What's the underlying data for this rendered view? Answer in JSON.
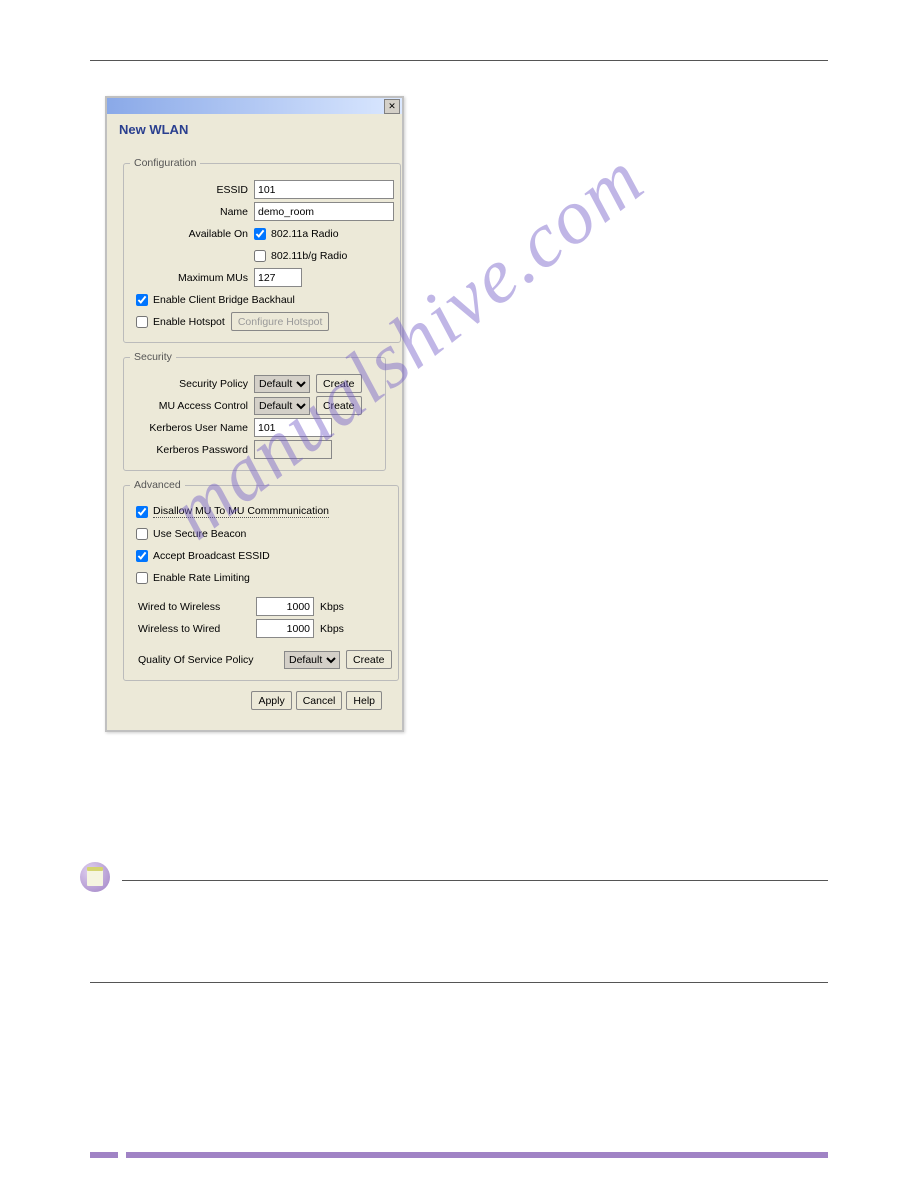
{
  "dialog": {
    "title": "New WLAN",
    "closeGlyph": "✕"
  },
  "configuration": {
    "legend": "Configuration",
    "essidLabel": "ESSID",
    "essid": "101",
    "nameLabel": "Name",
    "name": "demo_room",
    "availableOnLabel": "Available On",
    "radio80211a": {
      "checked": true,
      "label": "802.11a Radio"
    },
    "radio80211bg": {
      "checked": false,
      "label": "802.11b/g Radio"
    },
    "maxMUsLabel": "Maximum MUs",
    "maxMUs": "127",
    "enableClientBridge": {
      "checked": true,
      "label": "Enable Client Bridge Backhaul"
    },
    "enableHotspot": {
      "checked": false,
      "label": "Enable Hotspot"
    },
    "configureHotspotBtn": "Configure Hotspot"
  },
  "security": {
    "legend": "Security",
    "securityPolicyLabel": "Security Policy",
    "securityPolicy": "Default",
    "muAccessControlLabel": "MU Access Control",
    "muAccessControl": "Default",
    "createBtn": "Create",
    "kerberosUserNameLabel": "Kerberos User Name",
    "kerberosUserName": "101",
    "kerberosPasswordLabel": "Kerberos Password",
    "kerberosPassword": ""
  },
  "advanced": {
    "legend": "Advanced",
    "disallowMU": {
      "checked": true,
      "label": "Disallow MU To MU Commmunication"
    },
    "secureBeacon": {
      "checked": false,
      "label": "Use Secure Beacon"
    },
    "acceptBroadcast": {
      "checked": true,
      "label": "Accept Broadcast ESSID"
    },
    "rateLimiting": {
      "checked": false,
      "label": "Enable Rate Limiting"
    },
    "wiredToWirelessLabel": "Wired to Wireless",
    "wiredToWireless": "1000",
    "wirelessToWiredLabel": "Wireless to Wired",
    "wirelessToWired": "1000",
    "kbps": "Kbps",
    "qosLabel": "Quality Of Service Policy",
    "qos": "Default",
    "createBtn": "Create"
  },
  "buttons": {
    "apply": "Apply",
    "cancel": "Cancel",
    "help": "Help"
  },
  "watermark": "manualshive.com"
}
